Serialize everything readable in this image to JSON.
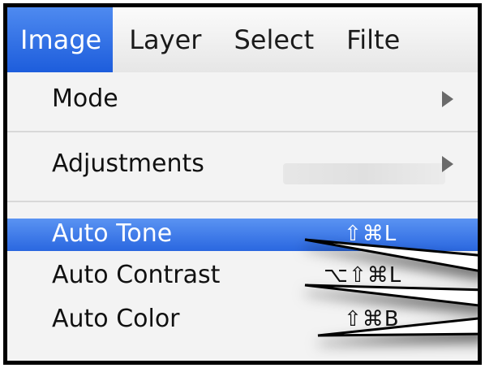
{
  "menubar": {
    "items": [
      "Image",
      "Layer",
      "Select",
      "Filte"
    ]
  },
  "menu": {
    "mode_label": "Mode",
    "adjustments_label": "Adjustments",
    "auto_tone_label": "Auto Tone",
    "auto_tone_shortcut": "⇧⌘L",
    "auto_contrast_label": "Auto Contrast",
    "auto_contrast_shortcut": "⌥⇧⌘L",
    "auto_color_label": "Auto Color",
    "auto_color_shortcut": "⇧⌘B"
  },
  "colors": {
    "highlight": "#2a67e0",
    "menubar_active": "#1d5ddc"
  }
}
